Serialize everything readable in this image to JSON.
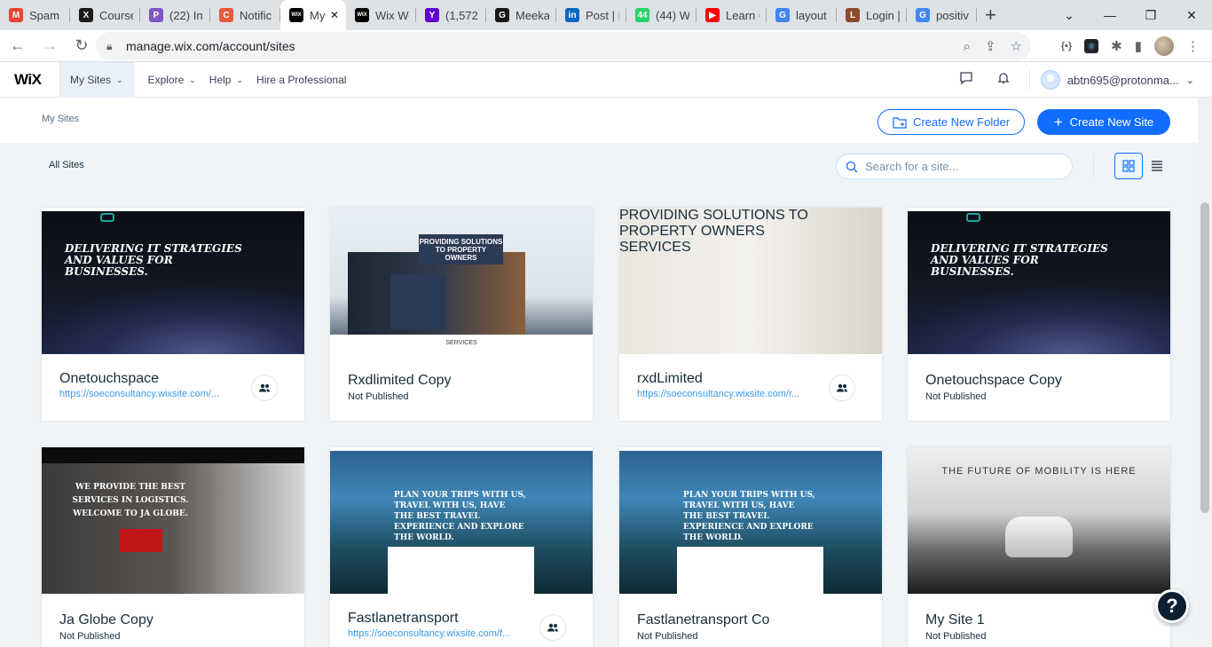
{
  "browser": {
    "tabs": [
      {
        "title": "Spam -",
        "fav": "M",
        "color": "#ea4335"
      },
      {
        "title": "Course",
        "fav": "X",
        "color": "#1b1b1b"
      },
      {
        "title": "(22) Int",
        "fav": "P",
        "color": "#7e57c2"
      },
      {
        "title": "Notific",
        "fav": "C",
        "color": "#e55a3c"
      },
      {
        "title": "My",
        "fav": "WIX",
        "color": "#000000",
        "active": true
      },
      {
        "title": "Wix We",
        "fav": "WIX",
        "color": "#000000"
      },
      {
        "title": "(1,572",
        "fav": "Y",
        "color": "#6001d2"
      },
      {
        "title": "Meekal",
        "fav": "G",
        "color": "#181717"
      },
      {
        "title": "Post | F",
        "fav": "in",
        "color": "#0a66c2"
      },
      {
        "title": "(44) W",
        "fav": "44",
        "color": "#25d366"
      },
      {
        "title": "Learn C",
        "fav": "▶",
        "color": "#ff0000"
      },
      {
        "title": "layout",
        "fav": "G",
        "color": "#4285f4"
      },
      {
        "title": "Login |",
        "fav": "L",
        "color": "#8d4b2c"
      },
      {
        "title": "positiv",
        "fav": "G",
        "color": "#4285f4"
      }
    ],
    "url": "manage.wix.com/account/sites",
    "icons": {
      "back": "arrow-left-icon",
      "forward": "arrow-right-icon",
      "reload": "reload-icon",
      "lock": "lock-icon"
    }
  },
  "wix": {
    "logo": "WiX",
    "nav": {
      "my_sites": "My Sites",
      "explore": "Explore",
      "help": "Help",
      "hire": "Hire a Professional"
    },
    "email": "abtn695@protonma..."
  },
  "subheader": {
    "breadcrumb": "My Sites",
    "create_folder": "Create New Folder",
    "create_site": "Create New Site"
  },
  "filter": {
    "all_sites": "All Sites",
    "search_placeholder": "Search for a site..."
  },
  "sites": [
    {
      "name": "Onetouchspace",
      "link": "https://soeconsultancy.wixsite.com/...",
      "collab": true,
      "thumb": "dark",
      "headline": "DELIVERING IT STRATEGIES AND VALUES FOR BUSINESSES."
    },
    {
      "name": "Rxdlimited Copy",
      "status": "Not Published",
      "collab": false,
      "thumb": "house",
      "headline": "PROVIDING SOLUTIONS TO PROPERTY OWNERS",
      "section": "SERVICES"
    },
    {
      "name": "rxdLimited",
      "link": "https://soeconsultancy.wixsite.com/r...",
      "collab": true,
      "thumb": "room",
      "headline": "PROVIDING SOLUTIONS TO PROPERTY OWNERS",
      "section": "SERVICES"
    },
    {
      "name": "Onetouchspace Copy",
      "status": "Not Published",
      "collab": false,
      "thumb": "dark",
      "headline": "DELIVERING IT STRATEGIES AND VALUES FOR BUSINESSES."
    },
    {
      "name": "Ja Globe Copy",
      "status": "Not Published",
      "collab": false,
      "thumb": "globe",
      "headline": "WE PROVIDE THE BEST SERVICES IN LOGISTICS. WELCOME TO JA GLOBE."
    },
    {
      "name": "Fastlanetransport",
      "link": "https://soeconsultancy.wixsite.com/f...",
      "collab": true,
      "thumb": "travel",
      "headline": "PLAN YOUR TRIPS WITH US, TRAVEL WITH US, HAVE THE BEST TRAVEL EXPERIENCE AND EXPLORE THE WORLD."
    },
    {
      "name": "Fastlanetransport Co",
      "status": "Not Published",
      "collab": false,
      "thumb": "travel",
      "headline": "PLAN YOUR TRIPS WITH US, TRAVEL WITH US, HAVE THE BEST TRAVEL EXPERIENCE AND EXPLORE THE WORLD."
    },
    {
      "name": "My Site 1",
      "status": "Not Published",
      "collab": false,
      "thumb": "auto",
      "headline": "THE FUTURE OF MOBILITY IS HERE"
    }
  ],
  "help_label": "?",
  "colors": {
    "accent": "#116dff",
    "link": "#3899ec",
    "text": "#162d3d",
    "page_bg": "#f0f4f7"
  }
}
